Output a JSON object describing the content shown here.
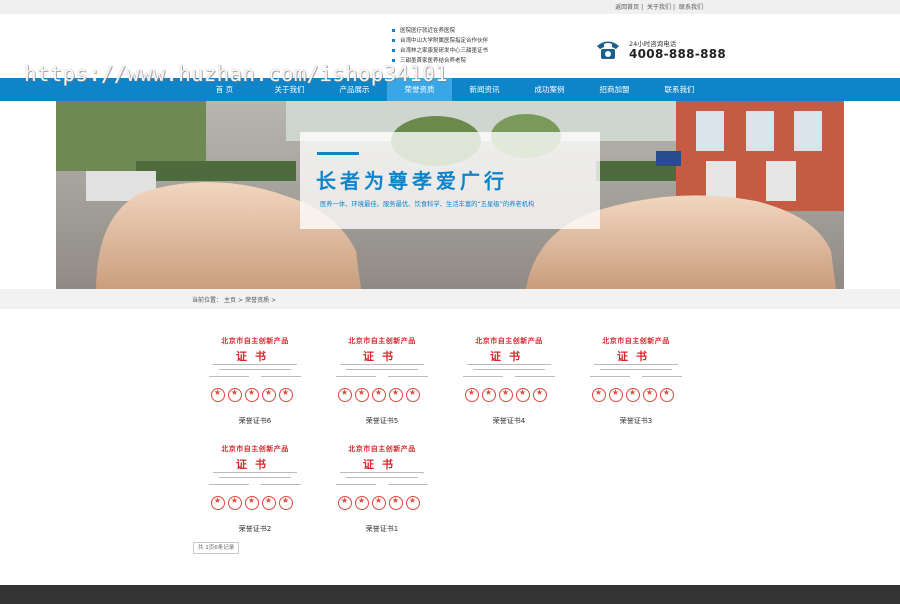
{
  "topbar": {
    "links": [
      "返回首页",
      "关于我们",
      "联系我们"
    ]
  },
  "header": {
    "bullets": [
      "医院医疗就近在养医院",
      "台湾中山大学附属医院指定合作伙伴",
      "台湾林之家康复研发中心三甜墨证书",
      "三甜墨首家医养结合养老院"
    ],
    "hotline_label": "24小时咨询电话",
    "hotline_number": "4008-888-888",
    "phone_icon": "phone-icon"
  },
  "nav": {
    "items": [
      "首 页",
      "关于我们",
      "产品展示",
      "荣誉资质",
      "新闻资讯",
      "成功案例",
      "招商加盟",
      "联系我们"
    ],
    "active_index": 3
  },
  "watermark": "https://www.huzhan.com/ishop34101",
  "banner": {
    "title": "长者为尊孝爱广行",
    "subtitle": "医养一体、环境最佳、服务最优、饮食科学、生活丰富的“五星级”的养老机构"
  },
  "breadcrumb": {
    "prefix": "当前位置：",
    "items": [
      "主页",
      "荣誉资质"
    ],
    "separator": ">"
  },
  "certificates": {
    "header_text": "北京市自主创新产品",
    "big_text": "证书",
    "items": [
      {
        "label": "荣誉证书6"
      },
      {
        "label": "荣誉证书5"
      },
      {
        "label": "荣誉证书4"
      },
      {
        "label": "荣誉证书3"
      },
      {
        "label": "荣誉证书2"
      },
      {
        "label": "荣誉证书1"
      }
    ]
  },
  "pager": {
    "text": "共 1页6条记录"
  },
  "colors": {
    "primary": "#0f84c9",
    "nav_active": "#39a6e6",
    "cert_red": "#d8282d",
    "footer": "#333333"
  }
}
